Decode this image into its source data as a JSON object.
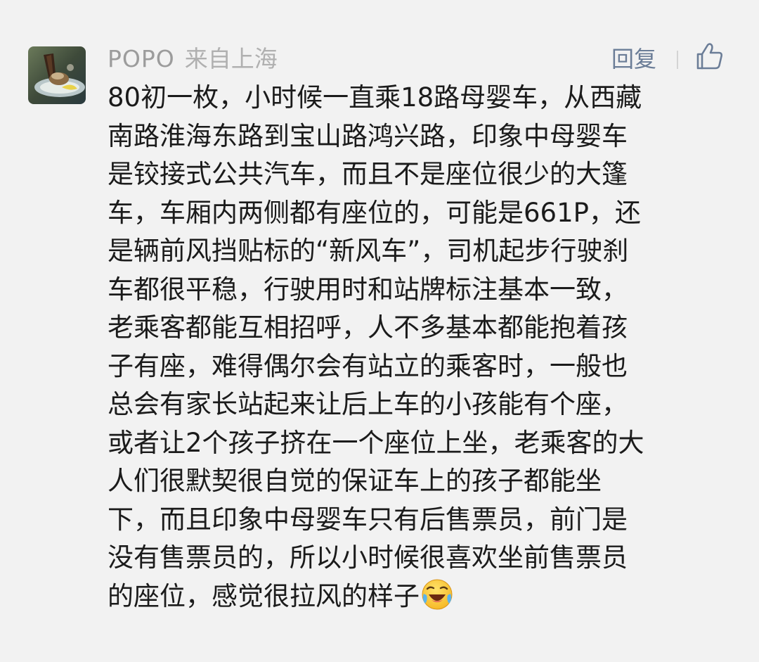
{
  "comment": {
    "username": "POPO",
    "location": "来自上海",
    "reply_label": "回复",
    "like_icon": "thumbs-up-icon",
    "avatar_icon": "avatar-photo",
    "emoji_icon": "laughing-crying-face-emoji",
    "text_lines": [
      "80初一枚，小时候一直乘18路母婴车，从西藏",
      "南路淮海东路到宝山路鸿兴路，印象中母婴车",
      "是铰接式公共汽车，而且不是座位很少的大篷",
      "车，车厢内两侧都有座位的，可能是661P，还",
      "是辆前风挡贴标的“新风车”，司机起步行驶刹",
      "车都很平稳，行驶用时和站牌标注基本一致，",
      "老乘客都能互相招呼，人不多基本都能抱着孩",
      "子有座，难得偶尔会有站立的乘客时，一般也",
      "总会有家长站起来让后上车的小孩能有个座，",
      "或者让2个孩子挤在一个座位上坐，老乘客的大",
      "人们很默契很自觉的保证车上的孩子都能坐",
      "下，而且印象中母婴车只有后售票员，前门是",
      "没有售票员的，所以小时候很喜欢坐前售票员",
      "的座位，感觉很拉风的样子"
    ]
  },
  "colors": {
    "background": "#f2f2f2",
    "username": "#9c9c9c",
    "reply": "#6b7d97",
    "text": "#1b1b1b"
  }
}
